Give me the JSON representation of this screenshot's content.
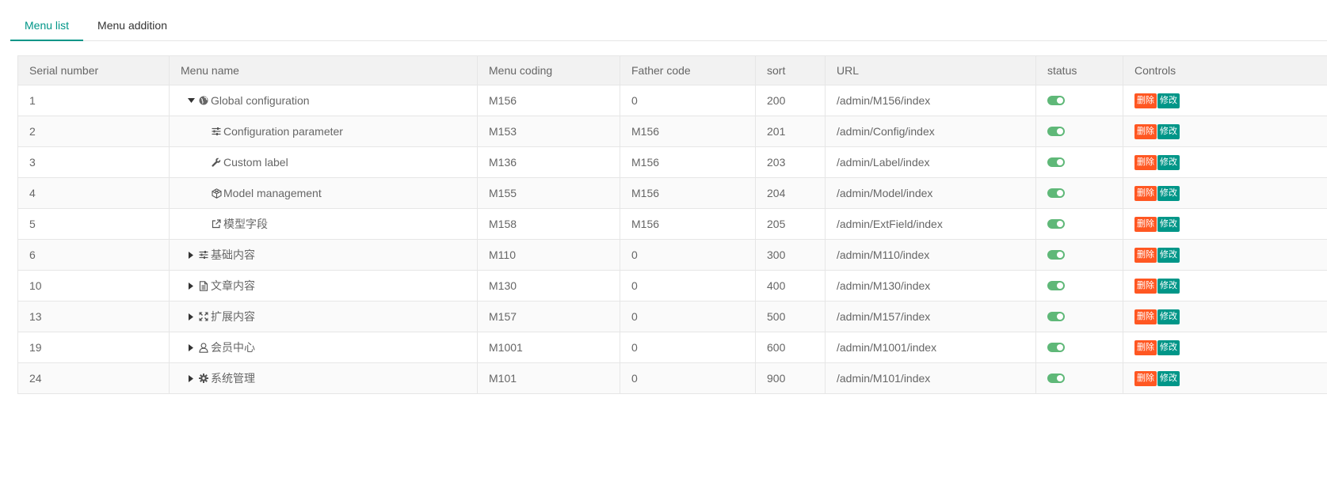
{
  "tabs": [
    {
      "label": "Menu list",
      "active": true
    },
    {
      "label": "Menu addition",
      "active": false
    }
  ],
  "table": {
    "headers": [
      "Serial number",
      "Menu name",
      "Menu coding",
      "Father code",
      "sort",
      "URL",
      "status",
      "Controls"
    ],
    "rows": [
      {
        "serial": "1",
        "name": "Global configuration",
        "icon": "globe-icon",
        "caret": "down",
        "code": "M156",
        "father": "0",
        "sort": "200",
        "url": "/admin/M156/index",
        "status_on": true,
        "delete_label": "删除",
        "edit_label": "修改"
      },
      {
        "serial": "2",
        "name": "Configuration parameter",
        "icon": "sliders-icon",
        "caret": "none",
        "code": "M153",
        "father": "M156",
        "sort": "201",
        "url": "/admin/Config/index",
        "status_on": true,
        "delete_label": "删除",
        "edit_label": "修改"
      },
      {
        "serial": "3",
        "name": "Custom label",
        "icon": "wrench-icon",
        "caret": "none",
        "code": "M136",
        "father": "M156",
        "sort": "203",
        "url": "/admin/Label/index",
        "status_on": true,
        "delete_label": "删除",
        "edit_label": "修改"
      },
      {
        "serial": "4",
        "name": "Model management",
        "icon": "cube-icon",
        "caret": "none",
        "code": "M155",
        "father": "M156",
        "sort": "204",
        "url": "/admin/Model/index",
        "status_on": true,
        "delete_label": "删除",
        "edit_label": "修改"
      },
      {
        "serial": "5",
        "name": "模型字段",
        "icon": "external-link-icon",
        "caret": "none",
        "code": "M158",
        "father": "M156",
        "sort": "205",
        "url": "/admin/ExtField/index",
        "status_on": true,
        "delete_label": "删除",
        "edit_label": "修改"
      },
      {
        "serial": "6",
        "name": "基础内容",
        "icon": "sliders-icon",
        "caret": "right",
        "code": "M110",
        "father": "0",
        "sort": "300",
        "url": "/admin/M110/index",
        "status_on": true,
        "delete_label": "删除",
        "edit_label": "修改"
      },
      {
        "serial": "10",
        "name": "文章内容",
        "icon": "document-icon",
        "caret": "right",
        "code": "M130",
        "father": "0",
        "sort": "400",
        "url": "/admin/M130/index",
        "status_on": true,
        "delete_label": "删除",
        "edit_label": "修改"
      },
      {
        "serial": "13",
        "name": "扩展内容",
        "icon": "expand-icon",
        "caret": "right",
        "code": "M157",
        "father": "0",
        "sort": "500",
        "url": "/admin/M157/index",
        "status_on": true,
        "delete_label": "删除",
        "edit_label": "修改"
      },
      {
        "serial": "19",
        "name": "会员中心",
        "icon": "user-icon",
        "caret": "right",
        "code": "M1001",
        "father": "0",
        "sort": "600",
        "url": "/admin/M1001/index",
        "status_on": true,
        "delete_label": "删除",
        "edit_label": "修改"
      },
      {
        "serial": "24",
        "name": "系统管理",
        "icon": "gear-icon",
        "caret": "right",
        "code": "M101",
        "father": "0",
        "sort": "900",
        "url": "/admin/M101/index",
        "status_on": true,
        "delete_label": "删除",
        "edit_label": "修改"
      }
    ]
  },
  "colors": {
    "accent": "#009688",
    "toggle_on": "#5fb878",
    "delete_button": "#ff5722",
    "edit_button": "#009688"
  }
}
